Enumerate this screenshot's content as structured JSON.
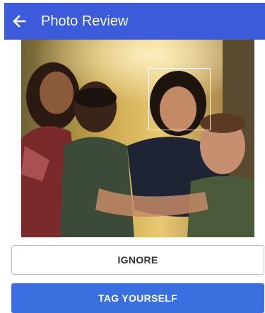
{
  "app_bar": {
    "title": "Photo Review",
    "back_icon": "arrow-left-icon",
    "color": "#3b5bdb"
  },
  "photo": {
    "face_box_visible": true
  },
  "actions": {
    "ignore_label": "IGNORE",
    "tag_label": "TAG YOURSELF",
    "tag_color": "#3b6fe0"
  }
}
